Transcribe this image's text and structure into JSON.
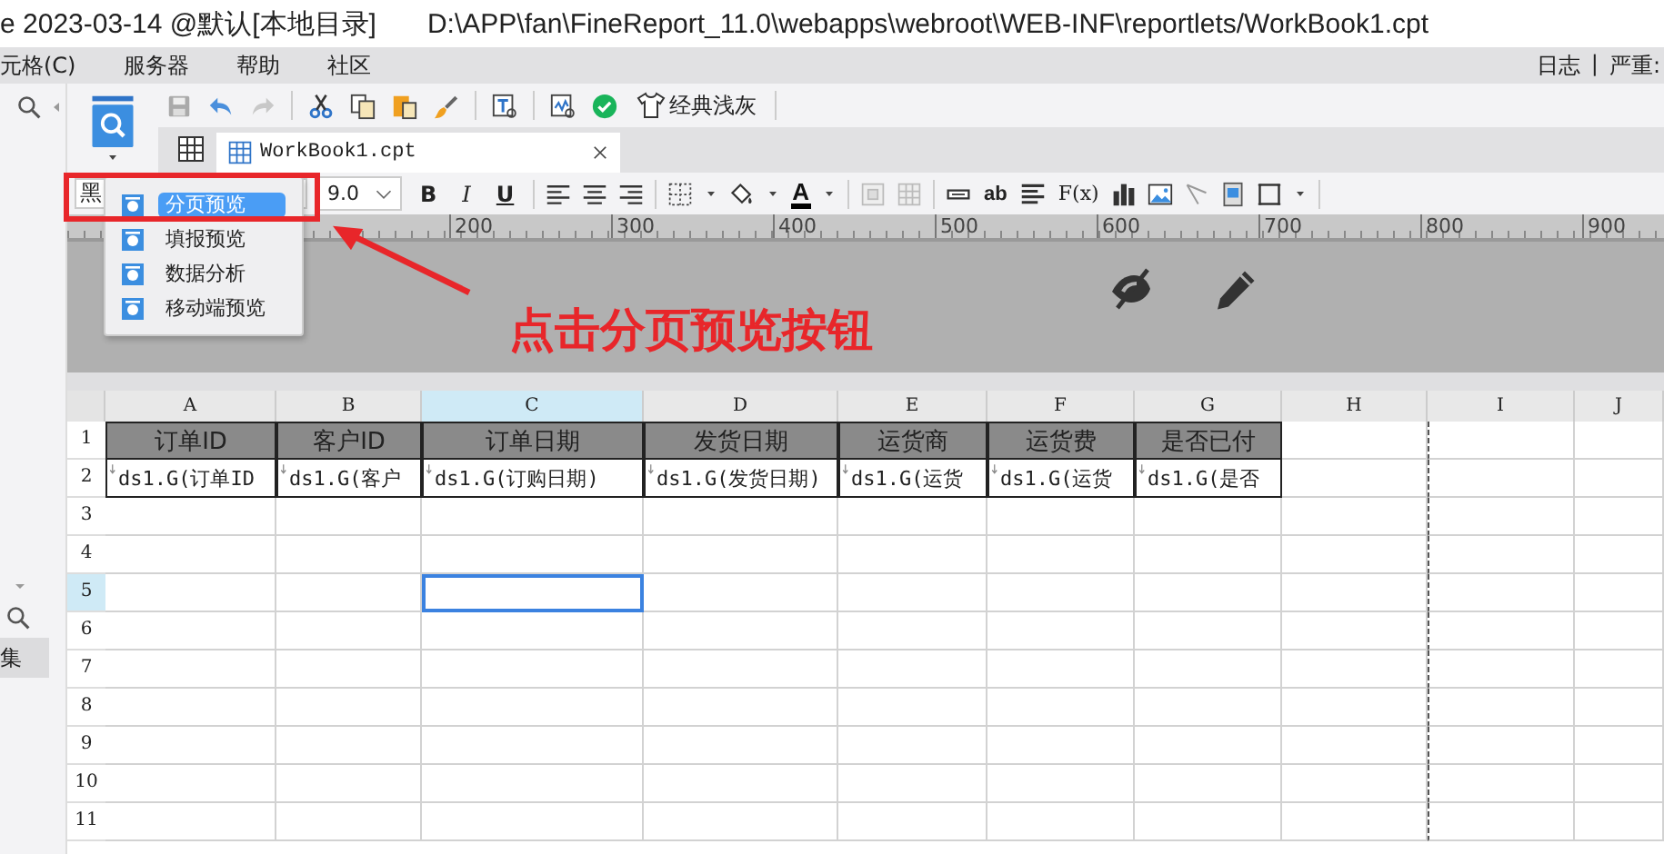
{
  "window": {
    "title": "e 2023-03-14 @默认[本地目录]",
    "path": "D:\\APP\\fan\\FineReport_11.0\\webapps\\webroot\\WEB-INF\\reportlets/WorkBook1.cpt"
  },
  "menu_bar": {
    "items": [
      "元格(C)",
      "服务器",
      "帮助",
      "社区"
    ],
    "right": [
      "日志",
      "|",
      "严重:"
    ]
  },
  "sidebar": {
    "item": "集"
  },
  "toolbar": {
    "theme_button": "经典浅灰"
  },
  "tabs": [
    {
      "label": "WorkBook1.cpt",
      "selected": true
    }
  ],
  "format_bar": {
    "font": "黑",
    "size": "9.0",
    "style_buttons": [
      "B",
      "I",
      "U"
    ],
    "font_color": "A",
    "text_tool": "ab",
    "formula_tool": "F(x)"
  },
  "ruler": [
    "200",
    "300",
    "400",
    "500",
    "600",
    "700",
    "800",
    "900"
  ],
  "preview_menu": {
    "items": [
      {
        "label": "分页预览",
        "selected": true
      },
      {
        "label": "填报预览",
        "selected": false
      },
      {
        "label": "数据分析",
        "selected": false
      },
      {
        "label": "移动端预览",
        "selected": false
      }
    ]
  },
  "annotation": {
    "text": "点击分页预览按钮"
  },
  "sheet": {
    "columns": [
      {
        "label": "A",
        "selected": false
      },
      {
        "label": "B",
        "selected": false
      },
      {
        "label": "C",
        "selected": true
      },
      {
        "label": "D",
        "selected": false
      },
      {
        "label": "E",
        "selected": false
      },
      {
        "label": "F",
        "selected": false
      },
      {
        "label": "G",
        "selected": false
      },
      {
        "label": "H",
        "selected": false
      },
      {
        "label": "I",
        "selected": false
      },
      {
        "label": "J",
        "selected": false
      }
    ],
    "rows": [
      {
        "label": "1",
        "selected": false,
        "cells": [
          {
            "kind": "header",
            "text": "订单ID"
          },
          {
            "kind": "header",
            "text": "客户ID"
          },
          {
            "kind": "header",
            "text": "订单日期"
          },
          {
            "kind": "header",
            "text": "发货日期"
          },
          {
            "kind": "header",
            "text": "运货商"
          },
          {
            "kind": "header",
            "text": "运货费"
          },
          {
            "kind": "header",
            "text": "是否已付"
          }
        ]
      },
      {
        "label": "2",
        "selected": false,
        "cells": [
          {
            "kind": "formula",
            "text": "ds1.G(订单ID"
          },
          {
            "kind": "formula",
            "text": "ds1.G(客户"
          },
          {
            "kind": "formula",
            "text": "ds1.G(订购日期)"
          },
          {
            "kind": "formula",
            "text": "ds1.G(发货日期)"
          },
          {
            "kind": "formula",
            "text": "ds1.G(运货"
          },
          {
            "kind": "formula",
            "text": "ds1.G(运货"
          },
          {
            "kind": "formula",
            "text": "ds1.G(是否"
          }
        ]
      },
      {
        "label": "3",
        "selected": false
      },
      {
        "label": "4",
        "selected": false
      },
      {
        "label": "5",
        "selected": true
      },
      {
        "label": "6",
        "selected": false
      },
      {
        "label": "7",
        "selected": false
      },
      {
        "label": "8",
        "selected": false
      },
      {
        "label": "9",
        "selected": false
      },
      {
        "label": "10",
        "selected": false
      },
      {
        "label": "11",
        "selected": false
      }
    ]
  }
}
